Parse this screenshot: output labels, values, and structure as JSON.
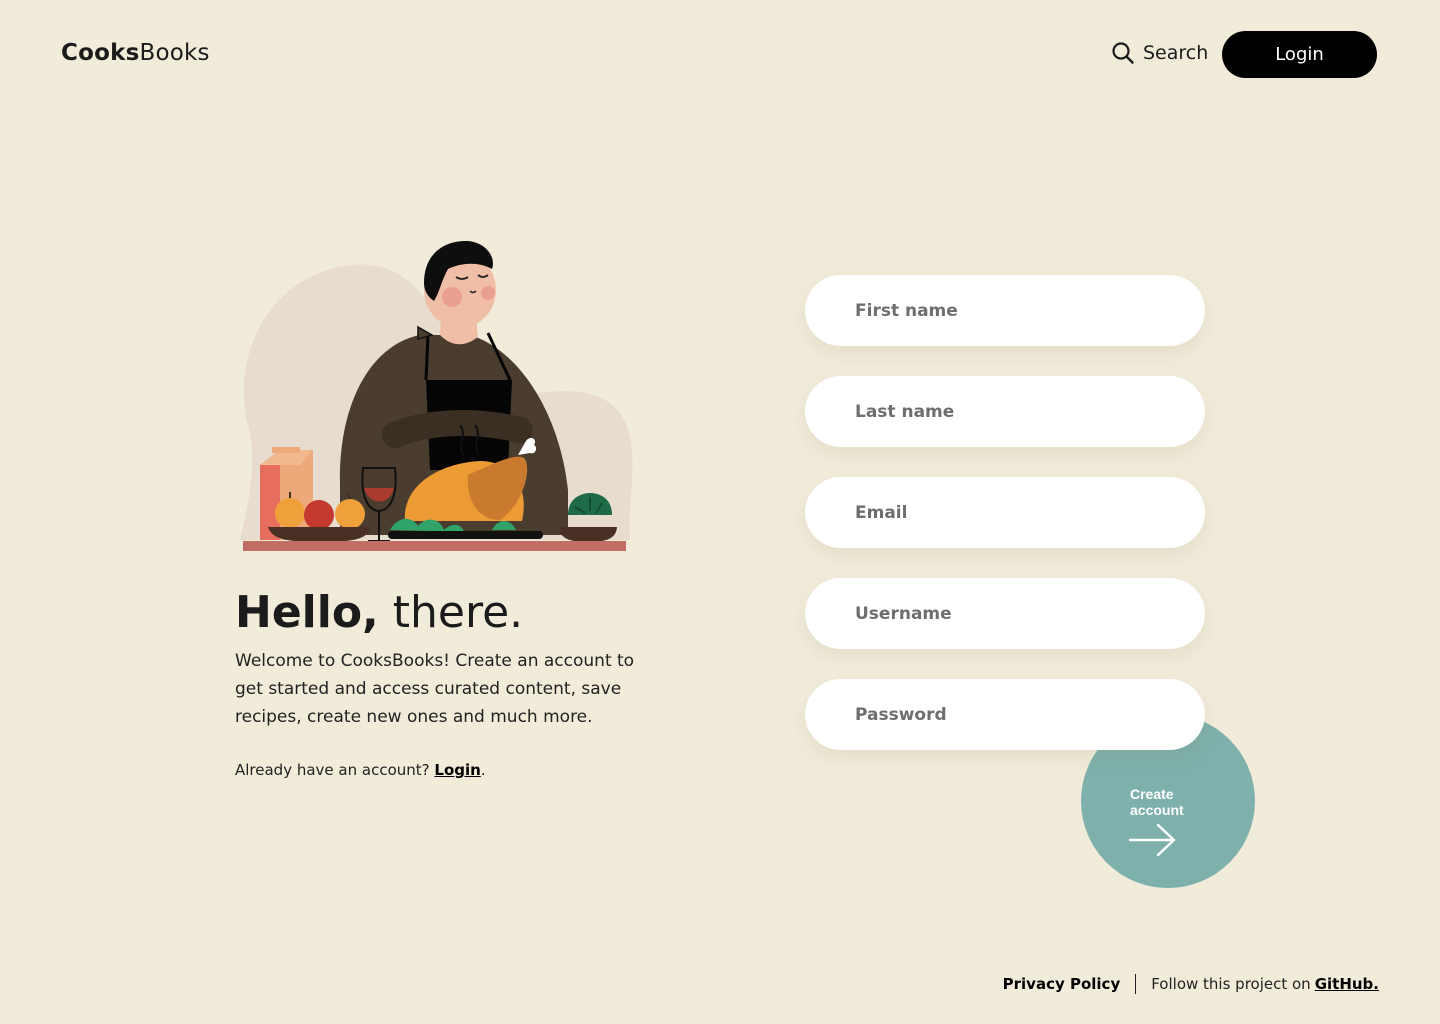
{
  "header": {
    "brand_bold": "Cooks",
    "brand_light": "Books",
    "search_label": "Search",
    "login_label": "Login"
  },
  "hero": {
    "title_strong": "Hello,",
    "title_normal": " there.",
    "description": "Welcome to CooksBooks! Create an account to get started and access curated content, save recipes, create new ones and much more.",
    "already_text": "Already have an account? ",
    "login_link": "Login",
    "period": "."
  },
  "form": {
    "first_name_placeholder": "First name",
    "last_name_placeholder": "Last name",
    "email_placeholder": "Email",
    "username_placeholder": "Username",
    "password_placeholder": "Password",
    "submit_label": "Create account"
  },
  "footer": {
    "privacy_label": "Privacy Policy",
    "follow_text": "Follow this project on",
    "github_label": "GitHub."
  },
  "colors": {
    "background": "#f1ebda",
    "primary_button": "#000000",
    "accent": "#7fb1ac",
    "field_background": "#ffffff"
  }
}
